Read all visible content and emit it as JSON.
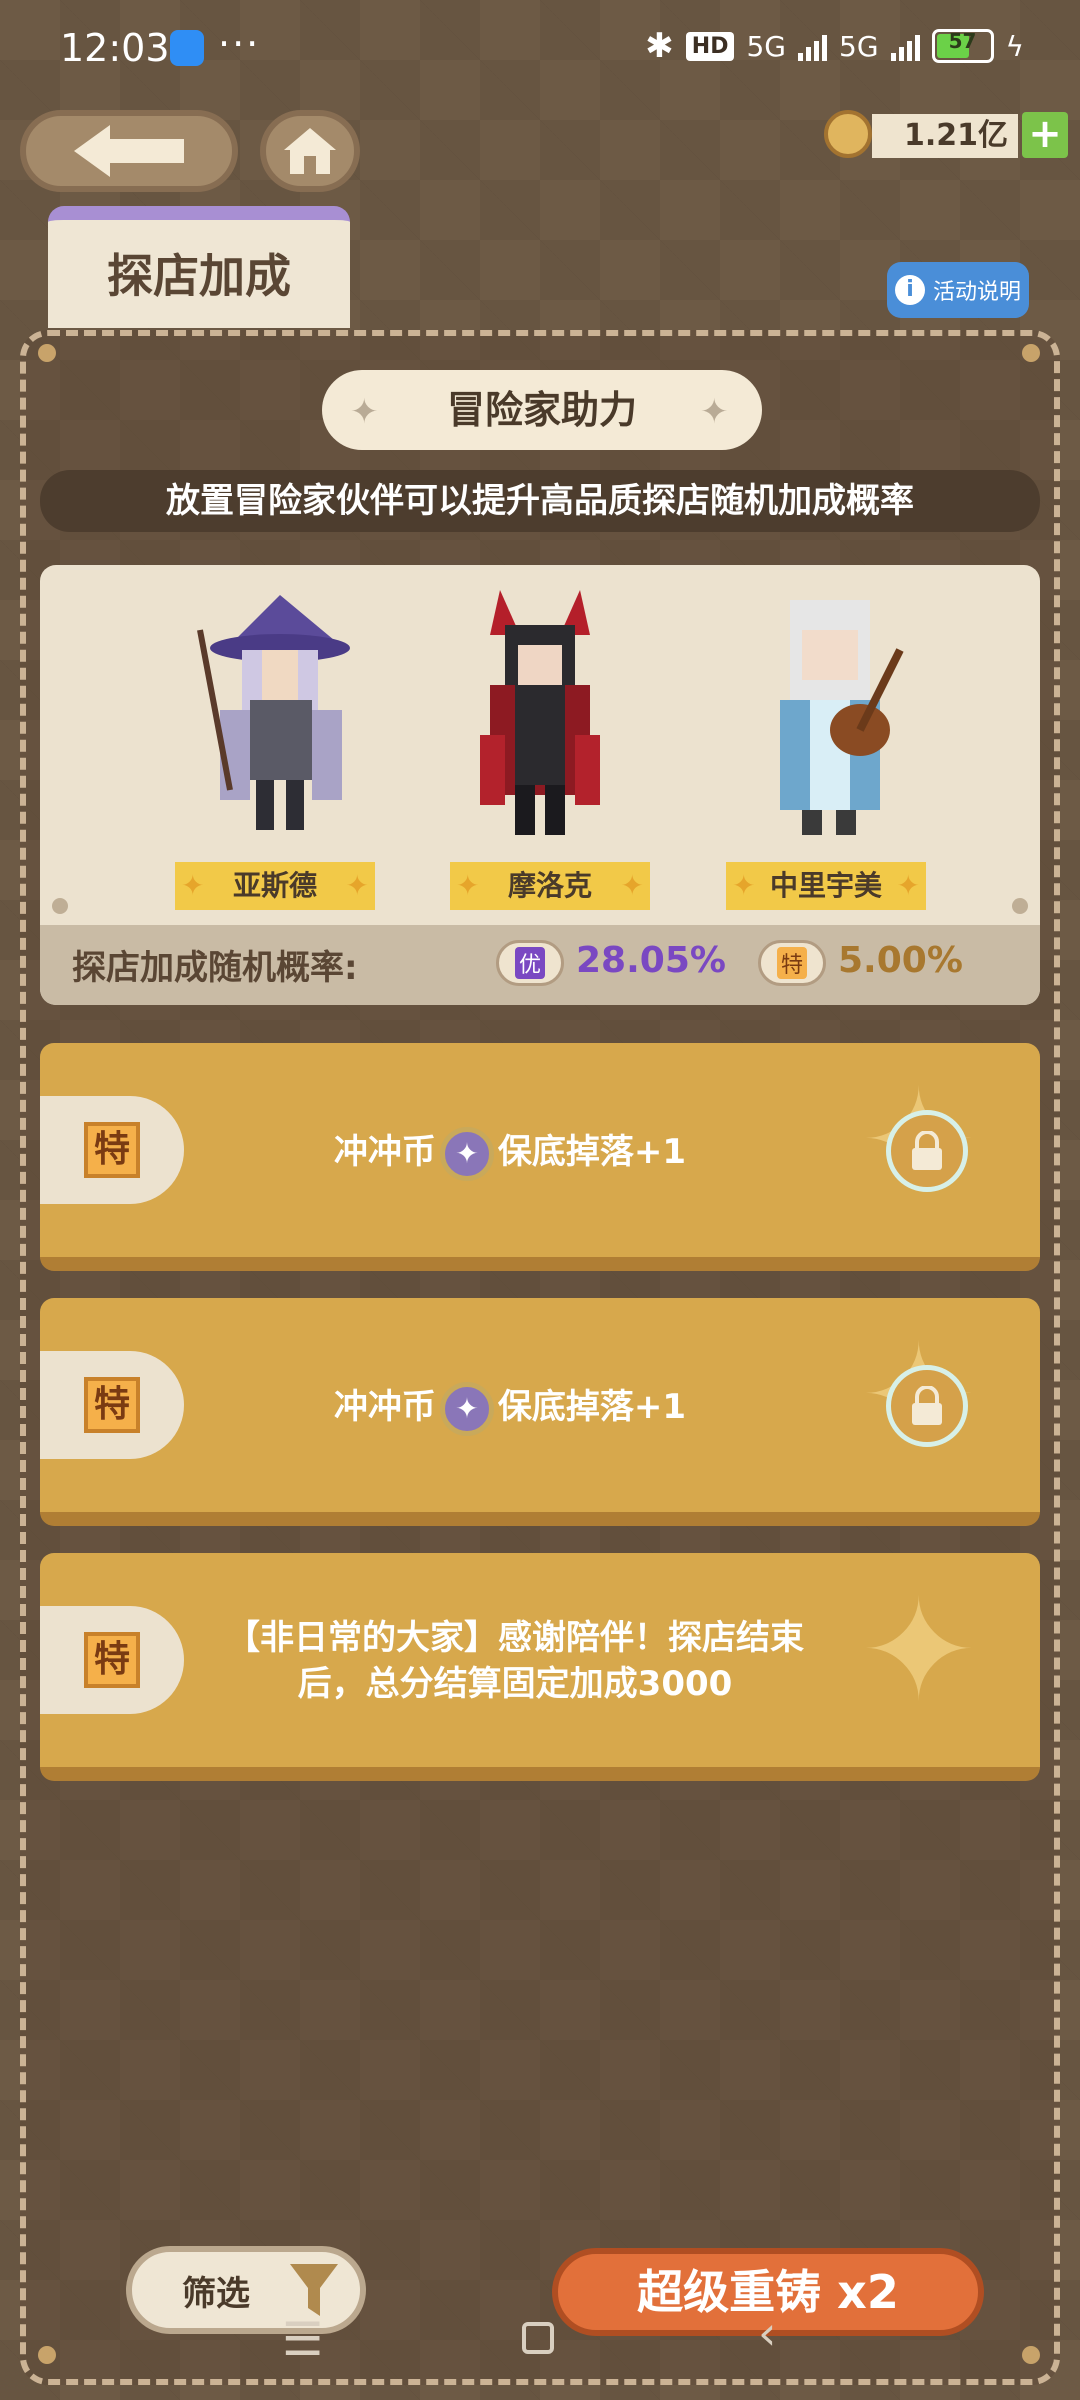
{
  "status_bar": {
    "time": "12:03",
    "more": "···",
    "hd": "HD",
    "signal_1": "5G",
    "signal_2": "5G",
    "battery": "57",
    "icons": [
      "bluetooth-icon",
      "hd-icon",
      "signal-icon",
      "battery-icon",
      "charging-icon"
    ]
  },
  "header": {
    "currency_amount": "1.21亿",
    "plus_label": "+"
  },
  "tab": {
    "title": "探店加成"
  },
  "info_button": {
    "label": "活动说明"
  },
  "panel": {
    "title": "冒险家助力",
    "subtitle": "放置冒险家伙伴可以提升高品质探店随机加成概率",
    "characters": [
      {
        "name": "亚斯德"
      },
      {
        "name": "摩洛克"
      },
      {
        "name": "中里宇美"
      }
    ],
    "probability": {
      "label": "探店加成随机概率:",
      "items": [
        {
          "badge": "优",
          "value": "28.05%",
          "color": "#7a48c2"
        },
        {
          "badge": "特",
          "value": "5.00%",
          "color": "#a8782f"
        }
      ]
    }
  },
  "bonuses": [
    {
      "badge": "特",
      "text_before": "冲冲币",
      "text_after": "保底掉落+1",
      "locked": true
    },
    {
      "badge": "特",
      "text_before": "冲冲币",
      "text_after": "保底掉落+1",
      "locked": true
    },
    {
      "badge": "特",
      "text_line1": "【非日常的大家】感谢陪伴！探店结束",
      "text_line2": "后，总分结算固定加成3000",
      "locked": false
    }
  ],
  "footer": {
    "filter_label": "筛选",
    "reforge_label": "超级重铸",
    "reforge_count": "x2"
  },
  "colors": {
    "background": "#6d5a45",
    "bonus_row": "#d7a84c",
    "reforge_button": "#e2703a",
    "accent_purple": "#7a48c2"
  }
}
